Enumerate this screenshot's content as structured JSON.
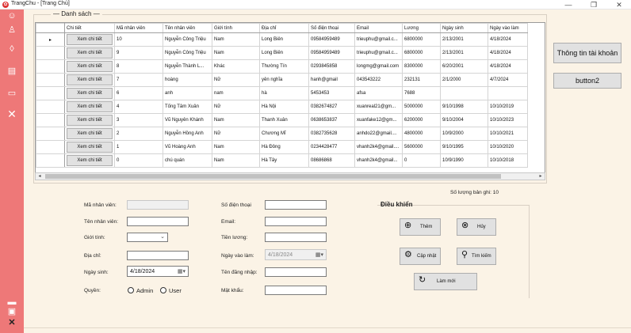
{
  "window": {
    "title": "TrangChu - [Trang Chủ]",
    "app_icon": "red-rose-icon",
    "controls": [
      "minimize",
      "maximize",
      "close"
    ]
  },
  "sidebar": {
    "color": "#ee7878",
    "icons": [
      "users-icon",
      "user-add-icon",
      "location-icon",
      "document-icon",
      "monitor-icon",
      "close-icon",
      "dash-icon",
      "printer-icon",
      "exit-icon"
    ]
  },
  "list_group": {
    "title": "— Danh sách —"
  },
  "grid": {
    "columns": [
      "Chi tiết",
      "Mã nhân viên",
      "Tên nhân viên",
      "Giới tính",
      "Địa chỉ",
      "Số điện thoại",
      "Email",
      "Lương",
      "Ngày sinh",
      "Ngày vào làm"
    ],
    "detail_label": "Xem chi tiết",
    "current_row_marker": "▸",
    "rows": [
      [
        "Xem chi tiết",
        "10",
        "Nguyễn Công Triệu",
        "Nam",
        "Long Biên",
        "09584959489",
        "trieuphu@gmail.c...",
        "6800000",
        "2/13/2001",
        "4/18/2024"
      ],
      [
        "Xem chi tiết",
        "9",
        "Nguyễn Công Triệu",
        "Nam",
        "Long Biên",
        "09584959489",
        "trieuphu@gmail.c...",
        "6800000",
        "2/13/2001",
        "4/18/2024"
      ],
      [
        "Xem chi tiết",
        "8",
        "Nguyễn Thành L...",
        "Khác",
        "Thường Tín",
        "0293845858",
        "longmg@gmail.com",
        "8300000",
        "6/20/2001",
        "4/18/2024"
      ],
      [
        "Xem chi tiết",
        "7",
        "hoàng",
        "Nữ",
        "yên nghĩa",
        "hanh@gmail",
        "043543222",
        "232131",
        "2/1/2000",
        "4/7/2024"
      ],
      [
        "Xem chi tiết",
        "6",
        "anh",
        "nam",
        "hà",
        "5453453",
        "afsa",
        "7688",
        "",
        ""
      ],
      [
        "Xem chi tiết",
        "4",
        "Tống Tâm Xuân",
        "Nữ",
        "Hà Nội",
        "0382674827",
        "xuanreal21@gm...",
        "5000000",
        "9/10/1998",
        "10/10/2019"
      ],
      [
        "Xem chi tiết",
        "3",
        "Vũ Nguyên Khánh",
        "Nam",
        "Thanh Xuân",
        "0638653837",
        "xuanfake12@gm...",
        "6200000",
        "9/10/2004",
        "10/10/2023"
      ],
      [
        "Xem chi tiết",
        "2",
        "Nguyễn Hồng Anh",
        "Nữ",
        "Chương Mĩ",
        "0382735628",
        "anhdo22@gmail....",
        "4800000",
        "10/9/2000",
        "10/10/2021"
      ],
      [
        "Xem chi tiết",
        "1",
        "Vũ Hoàng Anh",
        "Nam",
        "Hà Đông",
        "0234428477",
        "vhanh2k4@gmail....",
        "5600000",
        "9/10/1995",
        "10/10/2020"
      ],
      [
        "Xem chi tiết",
        "0",
        "chú quán",
        "Nam",
        "Hà Tây",
        "08686868",
        "vhanh2k4@gmail...",
        "0",
        "10/9/1990",
        "10/10/2018"
      ]
    ]
  },
  "side_buttons": {
    "account_info": "Thông tin tài khoản",
    "button2": "button2"
  },
  "record_count": "Số lượng bản ghi: 10",
  "form": {
    "labels": {
      "employee_id": "Mã nhân viên:",
      "employee_name": "Tên nhân viên:",
      "gender": "Giới tính:",
      "address": "Địa chỉ:",
      "birth_date": "Ngày sinh:",
      "role": "Quyền:",
      "phone": "Số điện thoại",
      "email": "Email:",
      "salary": "Tiền lương:",
      "start_date": "Ngày vào làm:",
      "username": "Tên đăng nhập:",
      "password": "Mật khẩu:"
    },
    "values": {
      "employee_id": "",
      "employee_name": "",
      "gender": "",
      "address": "",
      "birth_date": "4/18/2024",
      "phone": "",
      "email": "",
      "salary": "",
      "start_date": "4/18/2024",
      "username": "",
      "password": ""
    },
    "role_options": [
      "Admin",
      "User"
    ]
  },
  "controls": {
    "title": "Điều khiển",
    "add": "Thêm",
    "cancel": "Hủy",
    "update": "Cập nhật",
    "search": "Tìm kiếm",
    "refresh": "Làm mới"
  }
}
